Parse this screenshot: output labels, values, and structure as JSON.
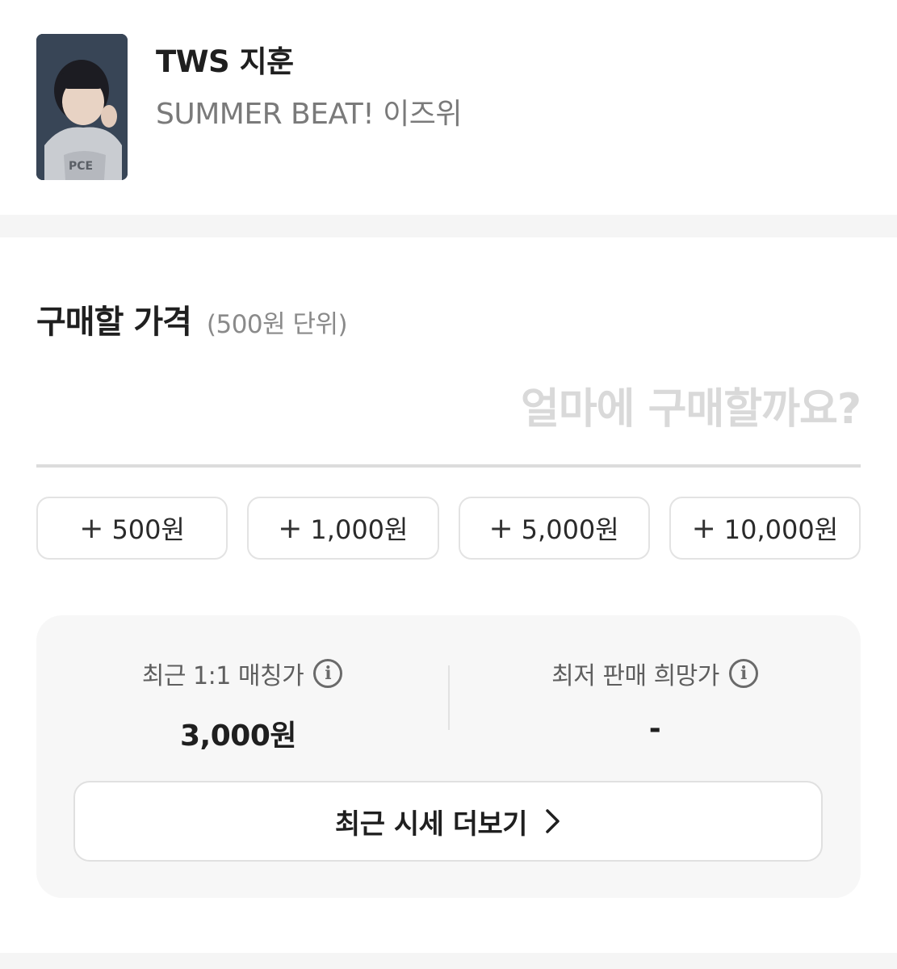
{
  "product": {
    "title": "TWS 지훈",
    "subtitle": "SUMMER BEAT! 이즈위",
    "thumbnail_icon": "photocard-image"
  },
  "purchase": {
    "section_title": "구매할 가격",
    "unit_note": "(500원 단위)",
    "price_placeholder": "얼마에 구매할까요?",
    "price_value": ""
  },
  "increments": [
    {
      "plus": "+",
      "label": "500원"
    },
    {
      "plus": "+",
      "label": "1,000원"
    },
    {
      "plus": "+",
      "label": "5,000원"
    },
    {
      "plus": "+",
      "label": "10,000원"
    }
  ],
  "stats": {
    "recent_match_label": "최근 1:1 매칭가",
    "recent_match_value": "3,000원",
    "lowest_ask_label": "최저 판매 희망가",
    "lowest_ask_value": "-",
    "info_glyph": "i"
  },
  "more_button": {
    "label": "최근 시세 더보기",
    "icon": "chevron-right-icon"
  },
  "colors": {
    "title": "#1f1f1f",
    "muted": "#7a7a7a",
    "placeholder": "#d9d9d9",
    "card_bg": "#f7f7f7",
    "band_bg": "#f5f5f5"
  }
}
